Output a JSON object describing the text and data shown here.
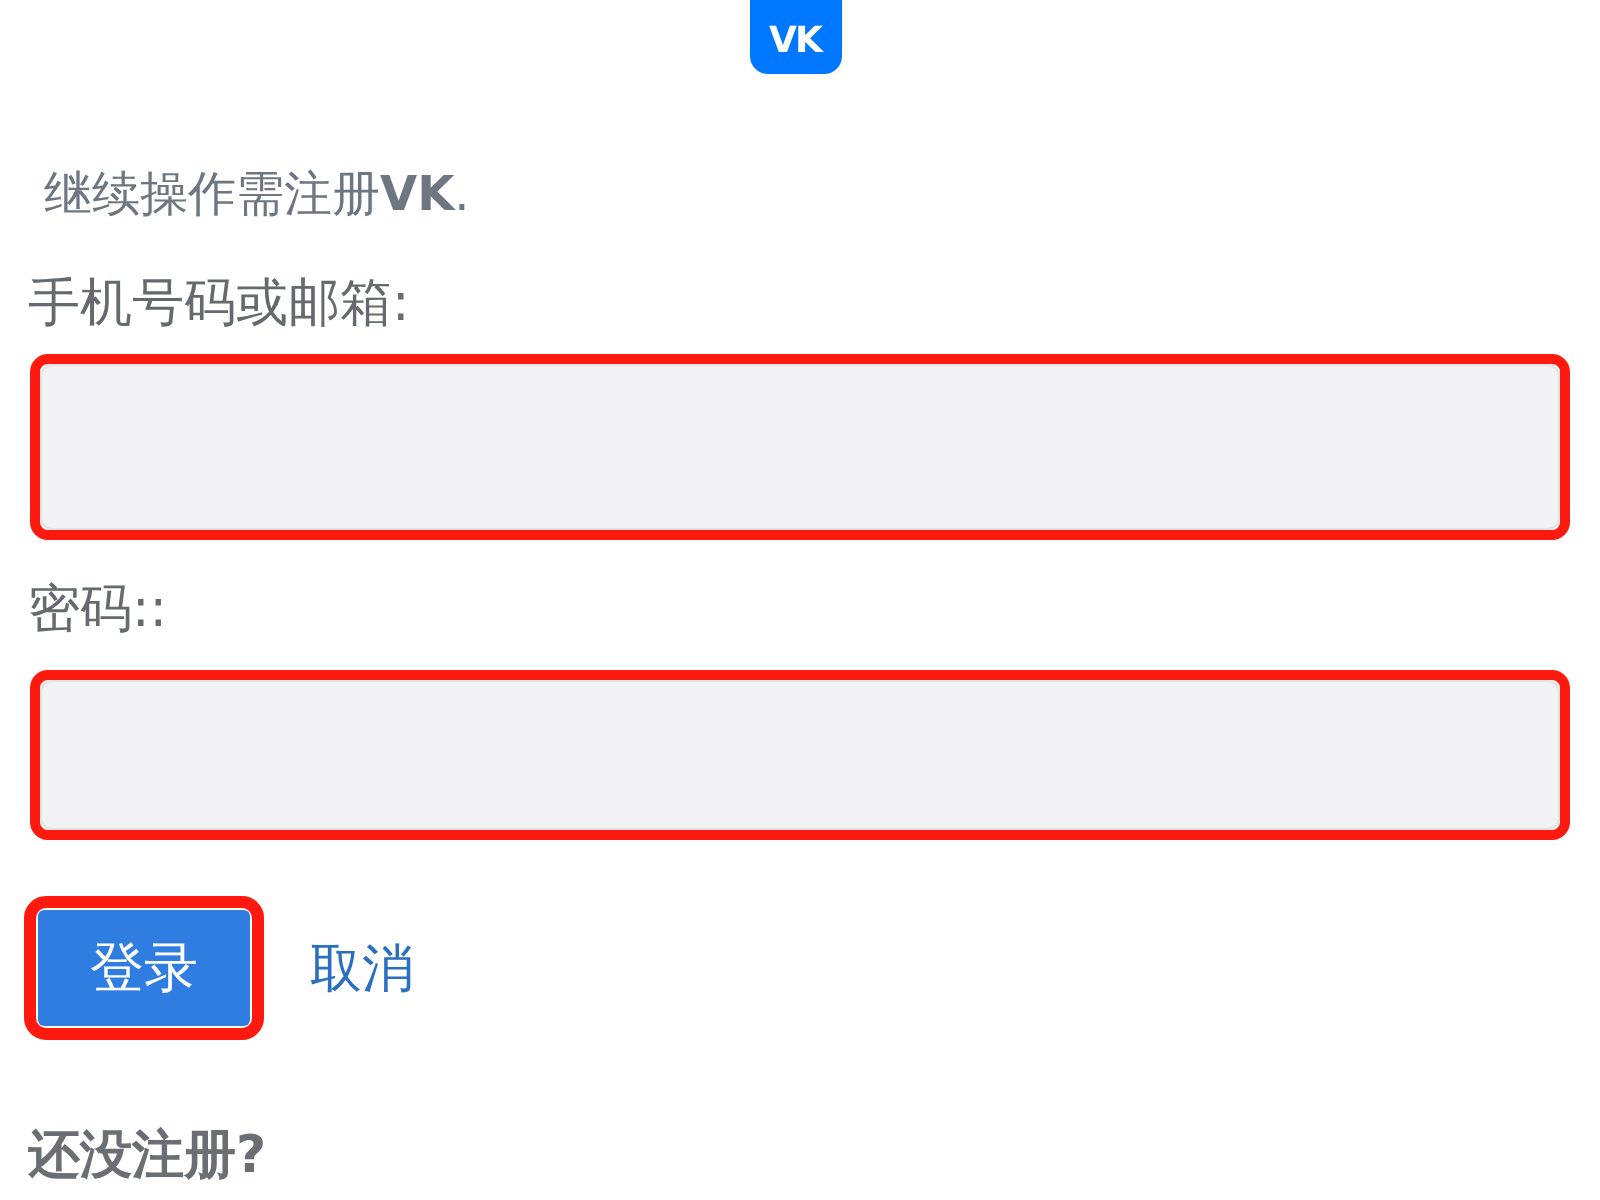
{
  "logo": {
    "text": "VK"
  },
  "intro": "继续操作需注册**VK**.",
  "fields": [
    {
      "label": "手机号码或邮箱:",
      "highlighted": true
    },
    {
      "label": "密码::",
      "highlighted": true
    }
  ],
  "login_button": {
    "label": "登录",
    "highlighted": true
  },
  "cancel_link": "取消",
  "footer": "还没注册?"
}
